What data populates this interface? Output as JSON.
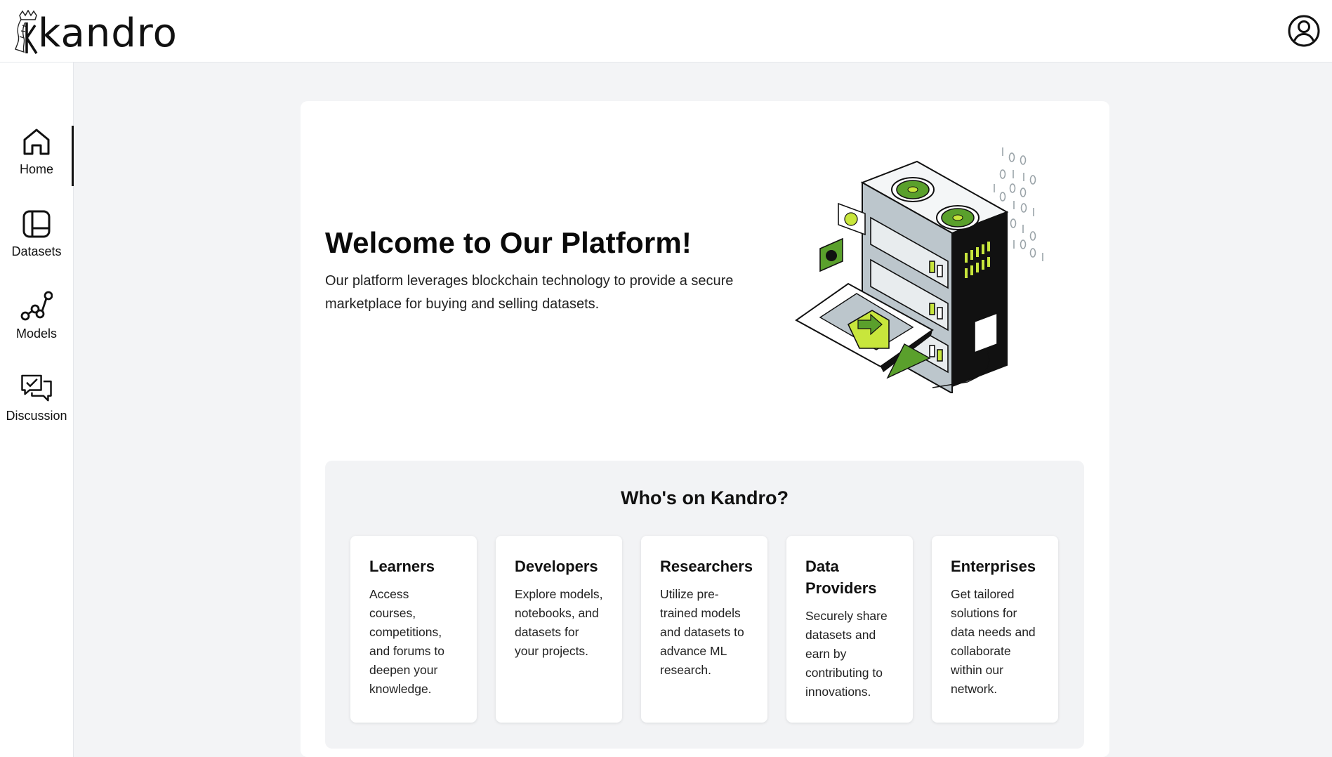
{
  "header": {
    "logo_text": "kandro",
    "profile_icon": "user-circle-icon"
  },
  "sidebar": {
    "items": [
      {
        "label": "Home",
        "icon": "home-icon",
        "active": true
      },
      {
        "label": "Datasets",
        "icon": "datasets-icon",
        "active": false
      },
      {
        "label": "Models",
        "icon": "models-icon",
        "active": false
      },
      {
        "label": "Discussion",
        "icon": "discussion-icon",
        "active": false
      }
    ]
  },
  "hero": {
    "title": "Welcome to Our Platform!",
    "text": "Our platform leverages blockchain technology to provide a secure marketplace for buying and selling datasets.",
    "illustration": "server-illustration"
  },
  "whos": {
    "title": "Who's on Kandro?",
    "cards": [
      {
        "title": "Learners",
        "desc": "Access courses, competitions, and forums to deepen your knowledge."
      },
      {
        "title": "Developers",
        "desc": "Explore models, notebooks, and datasets for your projects."
      },
      {
        "title": "Researchers",
        "desc": "Utilize pre-trained models and datasets to advance ML research."
      },
      {
        "title": "Data Providers",
        "desc": "Securely share datasets and earn by contributing to innovations."
      },
      {
        "title": "Enterprises",
        "desc": "Get tailored solutions for data needs and collaborate within our network."
      }
    ]
  },
  "colors": {
    "accent": "#c8e63c",
    "accent_dark": "#5aa02c",
    "server_gray": "#bcc6cc",
    "text": "#111111",
    "panel_bg": "#f2f3f5",
    "page_bg": "#f3f4f6"
  }
}
